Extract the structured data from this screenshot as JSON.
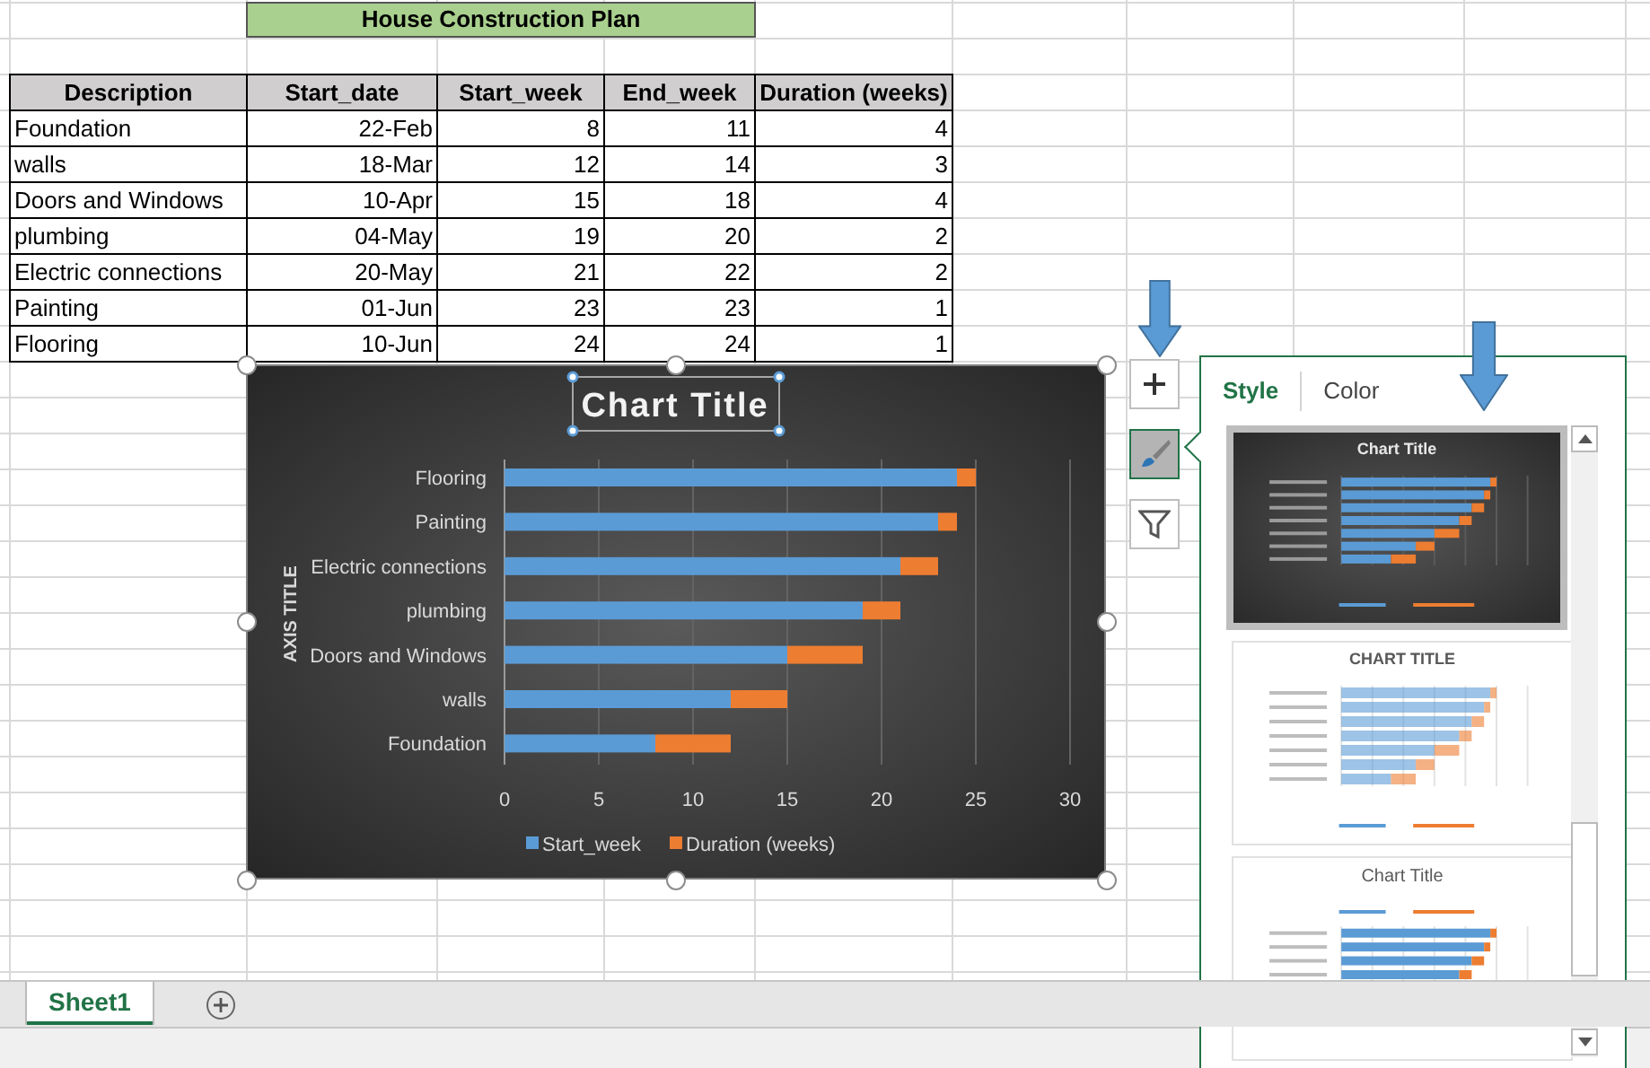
{
  "sheet": {
    "title_cell": "House Construction Plan",
    "table": {
      "columns": [
        "Description",
        "Start_date",
        "Start_week",
        "End_week",
        "Duration (weeks)"
      ],
      "rows": [
        [
          "Foundation",
          "22-Feb",
          "8",
          "11",
          "4"
        ],
        [
          "walls",
          "18-Mar",
          "12",
          "14",
          "3"
        ],
        [
          "Doors and Windows",
          "10-Apr",
          "15",
          "18",
          "4"
        ],
        [
          "plumbing",
          "04-May",
          "19",
          "20",
          "2"
        ],
        [
          "Electric connections",
          "20-May",
          "21",
          "22",
          "2"
        ],
        [
          "Painting",
          "01-Jun",
          "23",
          "23",
          "1"
        ],
        [
          "Flooring",
          "10-Jun",
          "24",
          "24",
          "1"
        ]
      ]
    }
  },
  "chart": {
    "selected": true,
    "title_selected": true,
    "chart_data": {
      "type": "bar",
      "orientation": "horizontal",
      "stacked": true,
      "title": "Chart Title",
      "ylabel": "AXIS TITLE",
      "categories": [
        "Flooring",
        "Painting",
        "Electric connections",
        "plumbing",
        "Doors and Windows",
        "walls",
        "Foundation"
      ],
      "series": [
        {
          "name": "Start_week",
          "color": "#5b9bd5",
          "values": [
            24,
            23,
            21,
            19,
            15,
            12,
            8
          ]
        },
        {
          "name": "Duration (weeks)",
          "color": "#ed7d31",
          "values": [
            1,
            1,
            2,
            2,
            4,
            3,
            4
          ]
        }
      ],
      "xlim": [
        0,
        30
      ],
      "xticks": [
        0,
        5,
        10,
        15,
        20,
        25,
        30
      ],
      "grid": true,
      "legend": true
    }
  },
  "chart_buttons": [
    {
      "kind": "elements",
      "selected": false
    },
    {
      "kind": "styles",
      "selected": true
    },
    {
      "kind": "filter",
      "selected": false
    }
  ],
  "style_panel": {
    "tabs": [
      {
        "label": "Style",
        "selected": true
      },
      {
        "label": "Color",
        "selected": false
      }
    ],
    "styles": [
      {
        "kind": "dark",
        "title": "Chart Title",
        "selected": true
      },
      {
        "kind": "light",
        "title": "CHART TITLE",
        "selected": false
      },
      {
        "kind": "legend_top",
        "title": "Chart Title",
        "selected": false
      }
    ]
  },
  "sheet_tabs": [
    {
      "label": "Sheet1",
      "selected": true
    }
  ]
}
